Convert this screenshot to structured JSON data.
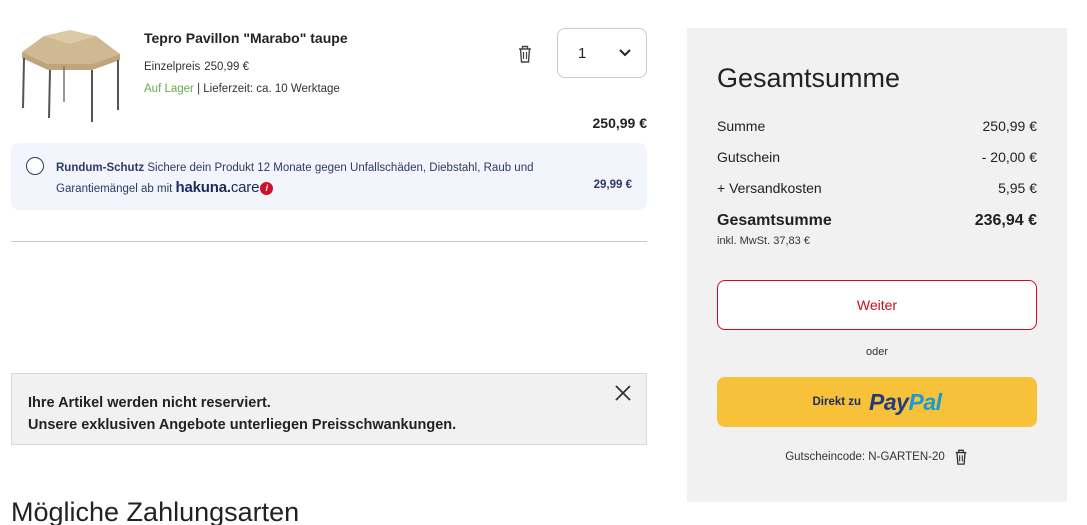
{
  "product": {
    "title": "Tepro Pavillon \"Marabo\" taupe",
    "unit_price_label": "Einzelpreis",
    "unit_price": "250,99 €",
    "stock_status": "Auf Lager",
    "delivery_label": " | Lieferzeit:  ca. 10 Werktage",
    "quantity": "1",
    "line_total": "250,99 €",
    "image_icon": "pavilion-image"
  },
  "protection": {
    "title": "Rundum-Schutz",
    "text_line1": " Sichere dein Produkt 12 Monate gegen Unfallschäden, Diebstahl, Raub und",
    "text_line2": "Garantiemängel ab mit ",
    "brand_hakuna": "hakuna.",
    "brand_care": "care",
    "info_glyph": "i",
    "price": "29,99 €"
  },
  "notice": {
    "line1": "Ihre Artikel werden nicht reserviert.",
    "line2": "Unsere exklusiven Angebote unterliegen Preisschwankungen."
  },
  "payment_heading": "Mögliche Zahlungsarten",
  "summary": {
    "title": "Gesamtsumme",
    "rows": [
      {
        "label": "Summe",
        "value": "250,99 €"
      },
      {
        "label": "Gutschein",
        "value": "- 20,00 €"
      },
      {
        "label": "+ Versandkosten",
        "value": "5,95 €"
      }
    ],
    "total_label": "Gesamtsumme",
    "total_value": "236,94 €",
    "vat": "inkl. MwSt. 37,83 €",
    "continue_button": "Weiter",
    "or_text": "oder",
    "paypal_label": "Direkt zu",
    "paypal_pay": "Pay",
    "paypal_pal": "Pal",
    "coupon_text": "Gutscheincode: N-GARTEN-20"
  },
  "colors": {
    "brand_red": "#cc0a24",
    "stock_green": "#6aa84f",
    "paypal_yellow": "#f7c23a",
    "panel_gray": "#f1f1f1",
    "protect_bg": "#f2f5fb"
  }
}
